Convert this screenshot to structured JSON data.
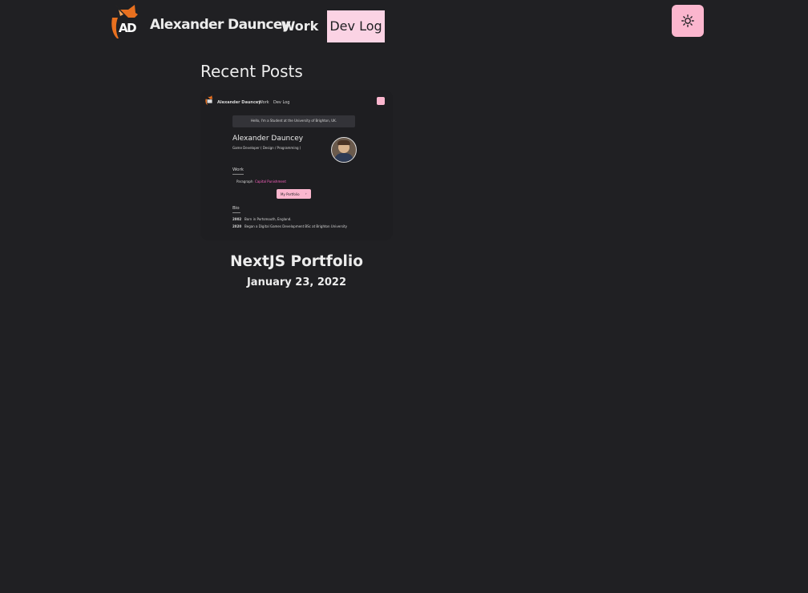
{
  "header": {
    "site_title": "Alexander Dauncey",
    "logo_text": "AD",
    "nav": {
      "work_label": "Work",
      "devlog_label": "Dev Log"
    },
    "theme_toggle_icon": "sun-icon"
  },
  "main": {
    "heading": "Recent Posts",
    "posts": [
      {
        "title": "NextJS Portfolio",
        "date": "January 23, 2022",
        "thumbnail": {
          "site_title": "Alexander Dauncey",
          "nav_work": "Work",
          "nav_devlog": "Dev Log",
          "hello_banner": "Hello, I'm a Student at the University of Brighton, UK.",
          "name": "Alexander Dauncey",
          "role": "Game Developer ( Design / Programming )",
          "work_heading": "Work",
          "work_paragraph_prefix": "Paragraph",
          "work_paragraph_link": "Capital Punishment",
          "portfolio_button": "My Portfolio",
          "bio_heading": "Bio",
          "bio": [
            {
              "year": "2002",
              "text": "Born in Portsmouth, England."
            },
            {
              "year": "2020",
              "text": "Began a Digital Games Development BSc at Brighton University"
            }
          ]
        }
      }
    ]
  },
  "colors": {
    "background": "#202023",
    "accent_pink": "#fbb6ce",
    "active_nav_bg": "#fbd3e4",
    "logo_orange": "#e8701f"
  }
}
